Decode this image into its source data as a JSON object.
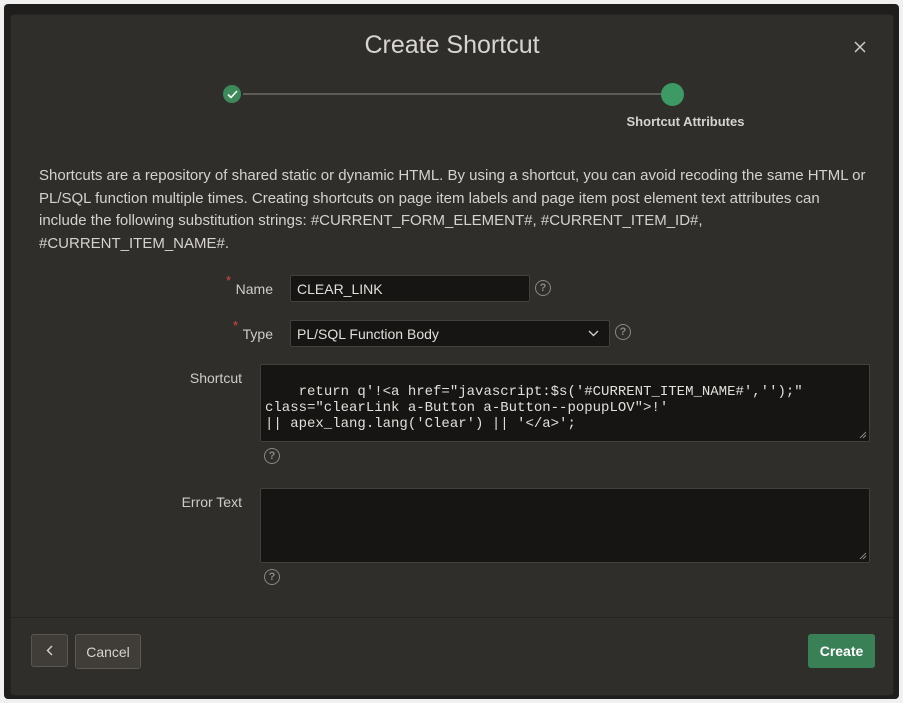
{
  "dialog": {
    "title": "Create Shortcut"
  },
  "wizard": {
    "current_step_label": "Shortcut Attributes"
  },
  "intro": {
    "text": "Shortcuts are a repository of shared static or dynamic HTML. By using a shortcut, you can avoid recoding the same HTML or PL/SQL function multiple times. Creating shortcuts on page item labels and page item post element text attributes can include the following substitution strings: #CURRENT_FORM_ELEMENT#, #CURRENT_ITEM_ID#, #CURRENT_ITEM_NAME#."
  },
  "form": {
    "name_label": "Name",
    "name_value": "CLEAR_LINK",
    "type_label": "Type",
    "type_value": "PL/SQL Function Body",
    "shortcut_label": "Shortcut",
    "shortcut_value": "return q'!<a href=\"javascript:$s('#CURRENT_ITEM_NAME#','');\"\nclass=\"clearLink a-Button a-Button--popupLOV\">!'\n|| apex_lang.lang('Clear') || '</a>';",
    "error_text_label": "Error Text",
    "error_text_value": "",
    "required_marker": "*",
    "help_glyph": "?"
  },
  "footer": {
    "cancel_label": "Cancel",
    "create_label": "Create"
  },
  "icons": {
    "close": "close-icon",
    "check": "check-icon",
    "back": "chevron-left-icon",
    "dropdown": "chevron-down-icon"
  },
  "colors": {
    "accent_green": "#3a8056",
    "required_red": "#d84a3c"
  }
}
